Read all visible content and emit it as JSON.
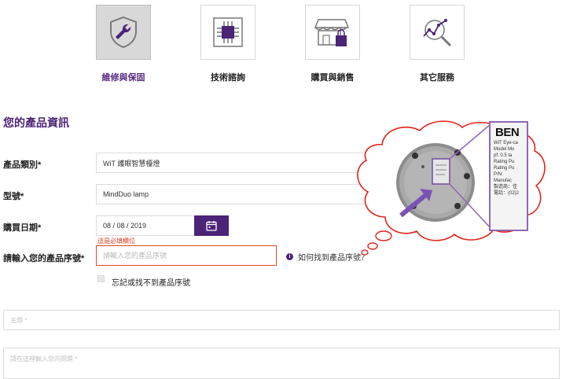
{
  "categories": [
    {
      "label": "維修與保固",
      "icon": "wrench-shield-icon",
      "active": true
    },
    {
      "label": "技術諮詢",
      "icon": "chip-icon",
      "active": false
    },
    {
      "label": "購買與銷售",
      "icon": "store-icon",
      "active": false
    },
    {
      "label": "其它服務",
      "icon": "analytics-search-icon",
      "active": false
    }
  ],
  "section_title": "您的產品資訊",
  "form": {
    "category": {
      "label": "產品類別*",
      "value": "WiT 護眼智慧檯燈"
    },
    "model": {
      "label": "型號*",
      "value": "MindDuo lamp"
    },
    "purchase_date": {
      "label": "購買日期*",
      "value": "08 / 08 / 2019"
    },
    "serial": {
      "label": "請輸入您的產品序號*",
      "placeholder": "請輸入您的產品序號",
      "error": "這是必填欄位",
      "help": "如何找到產品序號？"
    },
    "forgot": {
      "label": "忘記或找不到產品序號"
    },
    "subject": {
      "placeholder": "主題 *"
    },
    "message": {
      "placeholder": "請在這裡輸入您的問題 *"
    }
  },
  "label_plate": {
    "brand": "BEN",
    "lines": "WiT Eye-ca\nModel Mo\npf: 0.5 ta\nRating Pu\nRating Pu\nP/N:\nManufac\n製造商：佳\n電話：(02)2"
  },
  "colors": {
    "accent": "#4b2377",
    "error": "#e04a2f",
    "callout": "#e2231a"
  }
}
